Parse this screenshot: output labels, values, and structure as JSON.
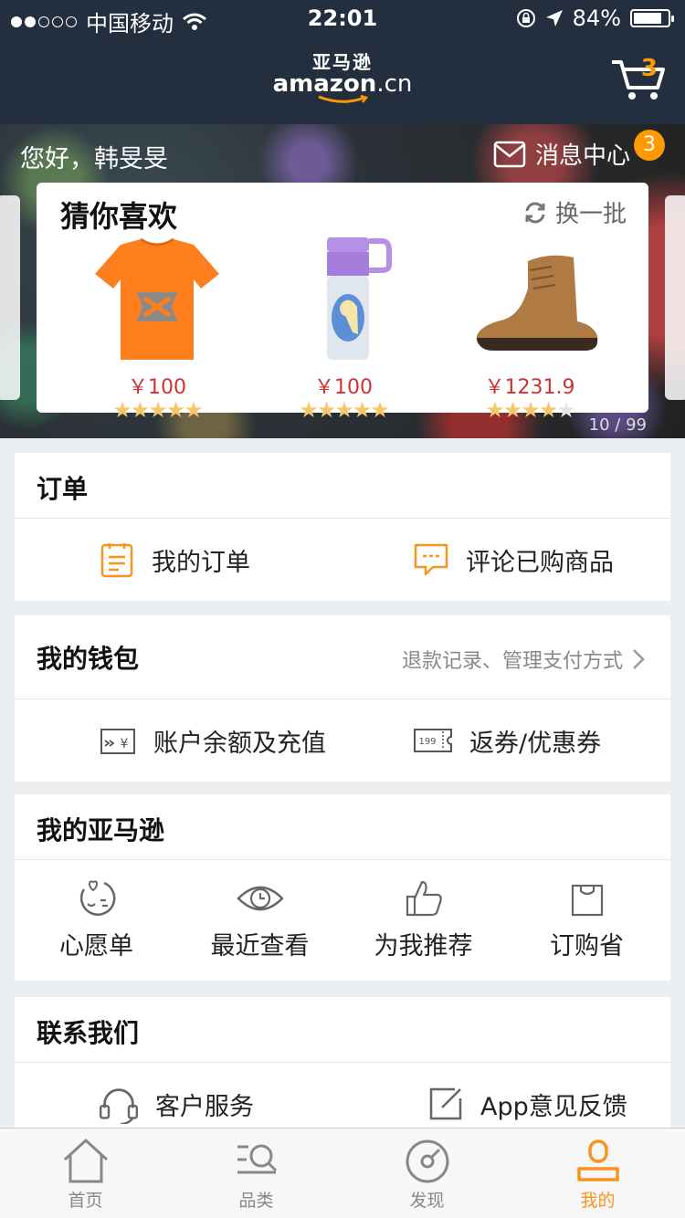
{
  "status_bar": {
    "carrier": "中国移动",
    "time": "22:01",
    "battery": "84%",
    "battery_level": 0.84,
    "signal_bars": 2
  },
  "header": {
    "logo_cn": "亚马逊",
    "logo_en": "amazon",
    "logo_suffix": ".cn",
    "cart_count": "3"
  },
  "banner": {
    "greeting": "您好，韩旻旻",
    "message_center": "消息中心",
    "message_badge": "3",
    "card_title": "猜你喜欢",
    "refresh_label": "换一批",
    "pager": "10 / 99",
    "products": [
      {
        "name": "orange-tshirt",
        "price": "￥100",
        "rating": 5
      },
      {
        "name": "frozen-thermos",
        "price": "￥100",
        "rating": 5
      },
      {
        "name": "suede-boot",
        "price": "￥1231.9",
        "rating": 4
      }
    ]
  },
  "orders": {
    "title": "订单",
    "items": [
      "我的订单",
      "评论已购商品"
    ]
  },
  "wallet": {
    "title": "我的钱包",
    "link": "退款记录、管理支付方式",
    "items": [
      "账户余额及充值",
      "返券/优惠券"
    ],
    "coupon_icon_text": "199"
  },
  "my_amazon": {
    "title": "我的亚马逊",
    "items": [
      "心愿单",
      "最近查看",
      "为我推荐",
      "订购省"
    ]
  },
  "contact": {
    "title": "联系我们",
    "items": [
      "客户服务",
      "App意见反馈"
    ]
  },
  "tabs": [
    {
      "label": "首页",
      "icon": "home-icon"
    },
    {
      "label": "品类",
      "icon": "category-search-icon"
    },
    {
      "label": "发现",
      "icon": "discover-icon"
    },
    {
      "label": "我的",
      "icon": "profile-icon",
      "active": true
    }
  ],
  "colors": {
    "header_bg": "#232f3e",
    "accent": "#f7931e",
    "price": "#c33333",
    "star": "#f6c66a"
  }
}
